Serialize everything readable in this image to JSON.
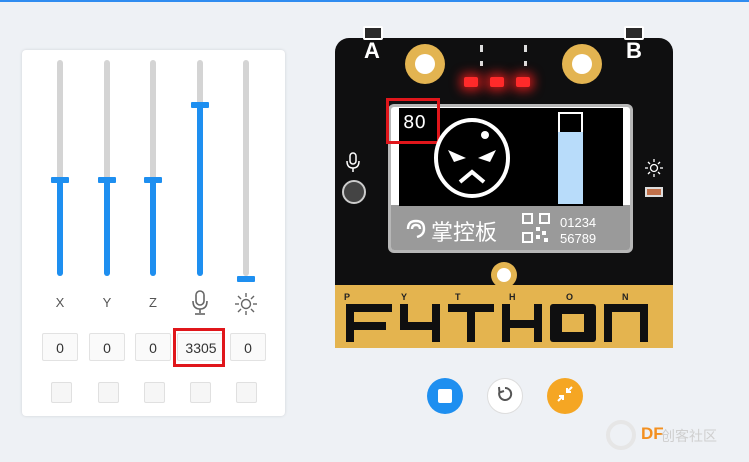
{
  "sensors": {
    "columns": [
      {
        "key": "x",
        "label": "X",
        "value": "0",
        "level": 0.5,
        "icon": null
      },
      {
        "key": "y",
        "label": "Y",
        "value": "0",
        "level": 0.5,
        "icon": null
      },
      {
        "key": "z",
        "label": "Z",
        "value": "0",
        "level": 0.5,
        "icon": null
      },
      {
        "key": "sound",
        "label": "",
        "value": "3305",
        "level": 0.81,
        "icon": "microphone-icon"
      },
      {
        "key": "light",
        "label": "",
        "value": "0",
        "level": 0.0,
        "icon": "sun-icon"
      }
    ]
  },
  "board": {
    "button_a": "A",
    "button_b": "B",
    "screen_number": "80",
    "screen_text": "掌控板",
    "screen_digits_1": "01234",
    "screen_digits_2": "56789",
    "pin_letters": [
      "P",
      "Y",
      "T",
      "H",
      "O",
      "N"
    ],
    "logo_text": "PYTHON"
  },
  "controls": {
    "stop": "stop-icon",
    "reset": "reset-icon",
    "fullscreen": "collapse-icon"
  },
  "watermark": {
    "brand": "DF",
    "sub": "创客社区"
  },
  "colors": {
    "accent": "#1e8ff0",
    "highlight": "#e0161b",
    "gold": "#e4b44f"
  }
}
